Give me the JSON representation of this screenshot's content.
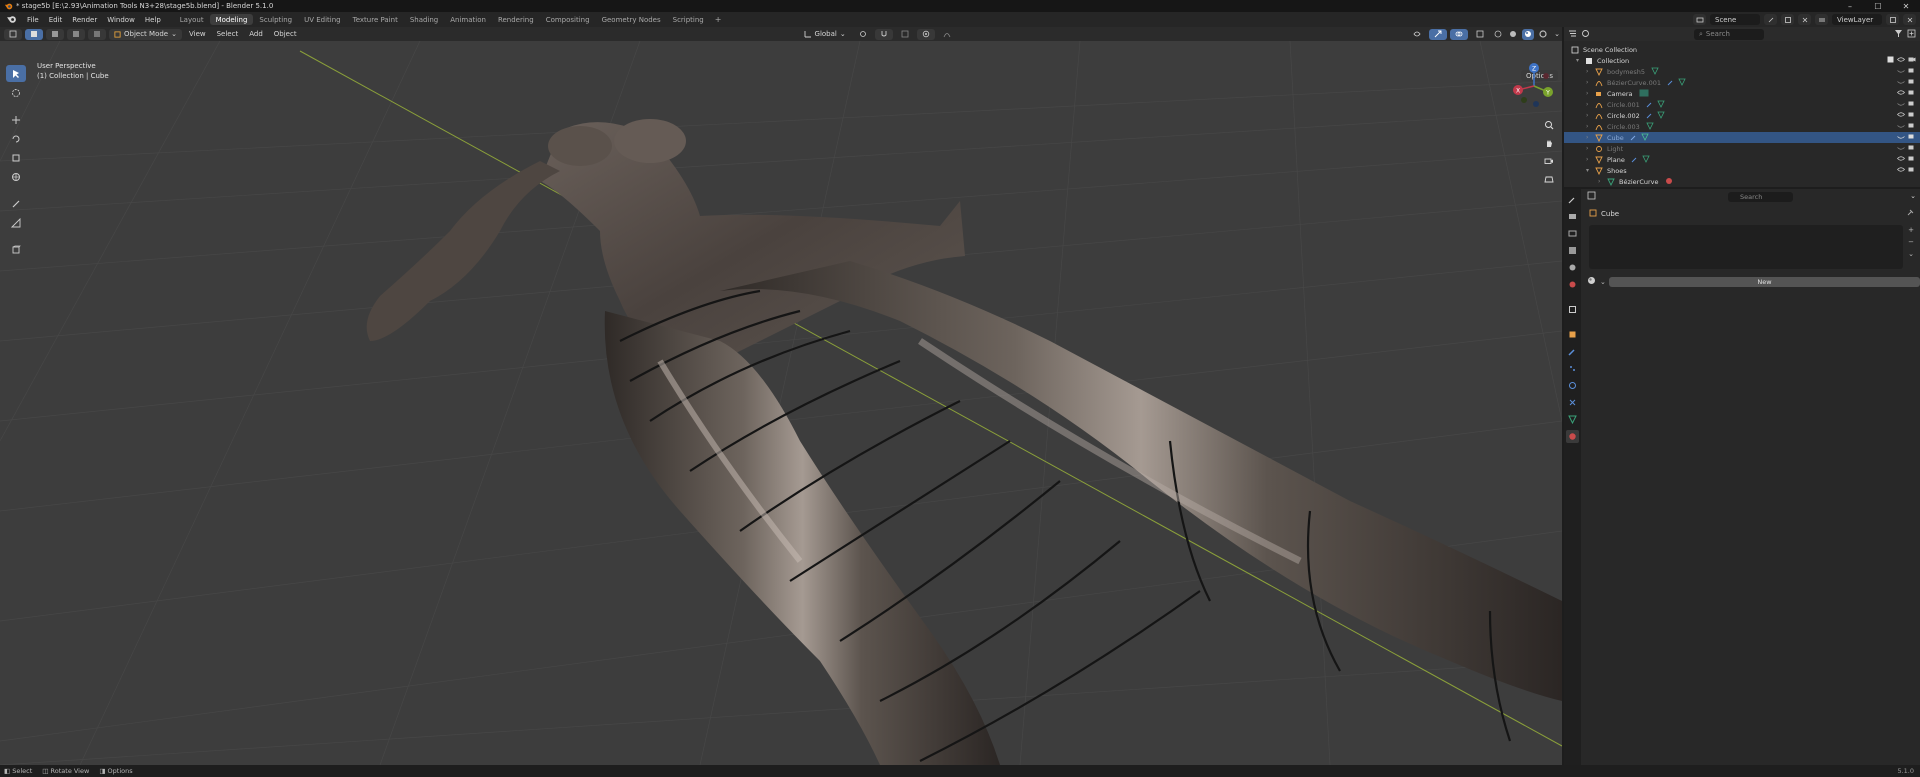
{
  "window": {
    "title": "* stage5b [E:\\2.93\\Animation Tools N3+28\\stage5b.blend] - Blender 5.1.0",
    "controls": [
      "–",
      "☐",
      "✕"
    ]
  },
  "menubar": {
    "items": [
      "File",
      "Edit",
      "Render",
      "Window",
      "Help"
    ],
    "workspaces": [
      "Layout",
      "Modeling",
      "Sculpting",
      "UV Editing",
      "Texture Paint",
      "Shading",
      "Animation",
      "Rendering",
      "Compositing",
      "Geometry Nodes",
      "Scripting"
    ],
    "active_workspace": "Modeling",
    "add_tab": "+",
    "scene": "Scene",
    "view_layer": "ViewLayer"
  },
  "viewport": {
    "mode": "Object Mode",
    "menus": [
      "View",
      "Select",
      "Add",
      "Object"
    ],
    "orientation": "Global",
    "options": "Options",
    "info_line1": "User Perspective",
    "info_line2": "(1) Collection | Cube",
    "gizmo": {
      "x": "X",
      "y": "Y",
      "z": "Z"
    },
    "colors": {
      "background": "#3d3d3d",
      "grid": "#4a4a4a",
      "x_axis": "#8a9f3a",
      "mesh": "#5a524c",
      "selection": "#4a6fa5"
    }
  },
  "outliner": {
    "search_placeholder": "Search",
    "scene_collection": "Scene Collection",
    "collection": "Collection",
    "items": [
      {
        "name": "bodymesh5",
        "type": "mesh",
        "dim": true
      },
      {
        "name": "BézierCurve.001",
        "type": "curve",
        "dim": true
      },
      {
        "name": "Camera",
        "type": "camera",
        "dim": false
      },
      {
        "name": "Circle.001",
        "type": "curve",
        "dim": true
      },
      {
        "name": "Circle.002",
        "type": "curve",
        "dim": false
      },
      {
        "name": "Circle.003",
        "type": "curve",
        "dim": true
      },
      {
        "name": "Cube",
        "type": "mesh",
        "dim": false,
        "selected": true
      },
      {
        "name": "Light",
        "type": "light",
        "dim": true
      },
      {
        "name": "Plane",
        "type": "mesh",
        "dim": false
      },
      {
        "name": "Shoes",
        "type": "mesh",
        "dim": false
      },
      {
        "name": "BézierCurve",
        "type": "curve",
        "dim": false,
        "child": true
      }
    ]
  },
  "properties": {
    "search_placeholder": "Search",
    "context_object": "Cube",
    "new_button": "New",
    "add_slot": "+",
    "remove_slot": "−"
  },
  "statusbar": {
    "items": [
      "Select",
      "Rotate View",
      "Options"
    ],
    "version": "5.1.0"
  }
}
